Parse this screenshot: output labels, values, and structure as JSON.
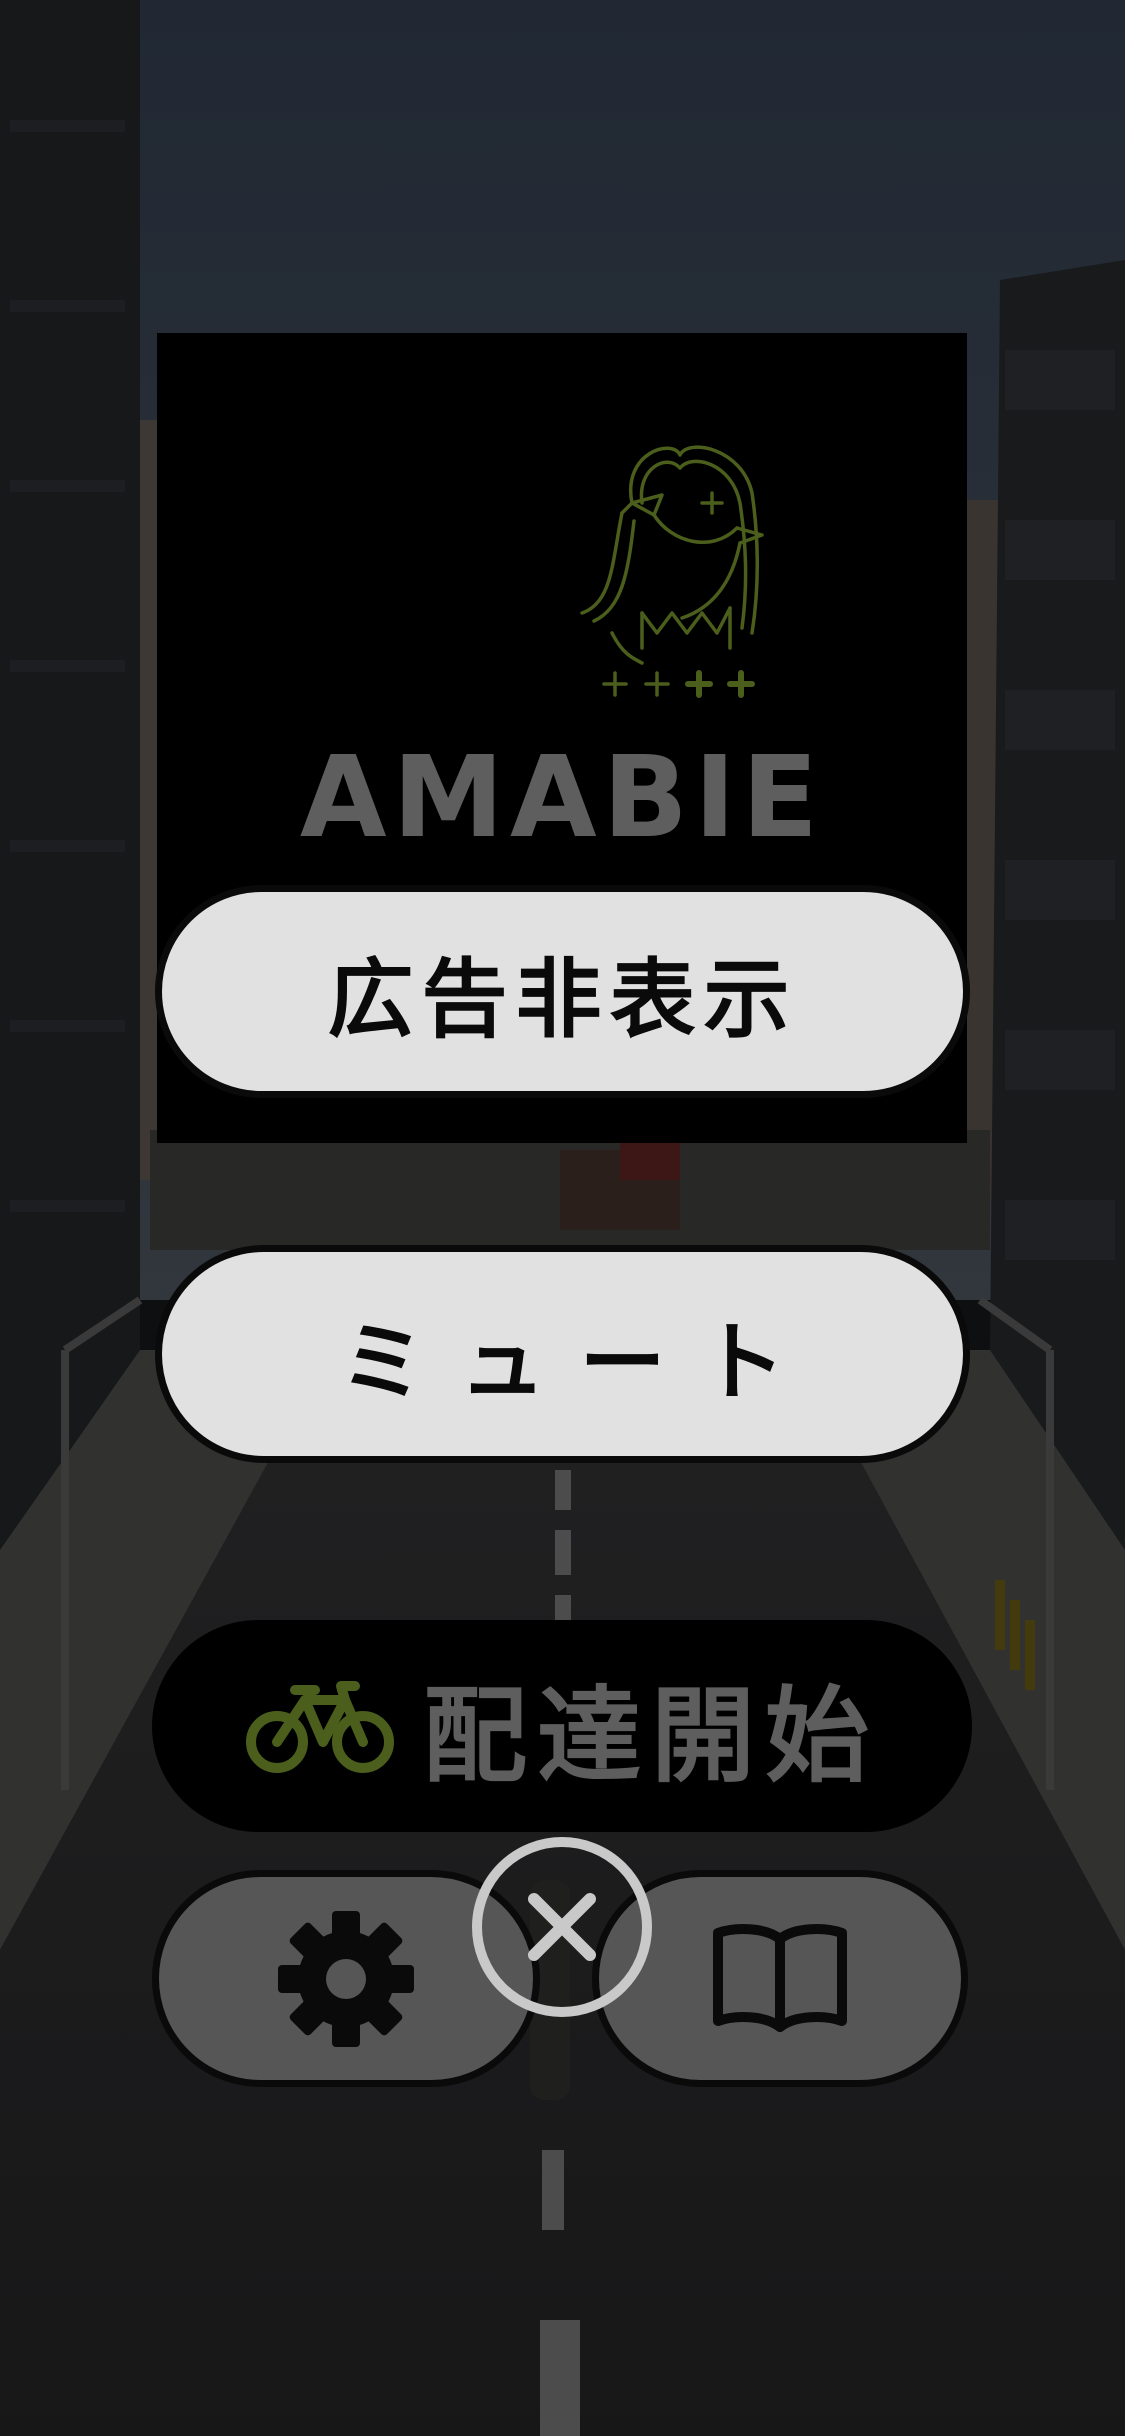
{
  "ad_box": {
    "logo_text": "AMABIE"
  },
  "menu": {
    "hide_ads_label": "広告非表示",
    "mute_label": "ミュート",
    "start_delivery_label": "配達開始"
  },
  "icons": {
    "bicycle": "bicycle-icon",
    "settings": "gear-icon",
    "guide": "book-icon",
    "close": "close-icon",
    "logo": "amabie-logo"
  },
  "colors": {
    "logo_green": "#4b5e1c",
    "logo_text": "#5e5e5e",
    "light_button": "#e1e1e1",
    "dark_button": "#565656",
    "close_ring": "#c9c9c9"
  }
}
